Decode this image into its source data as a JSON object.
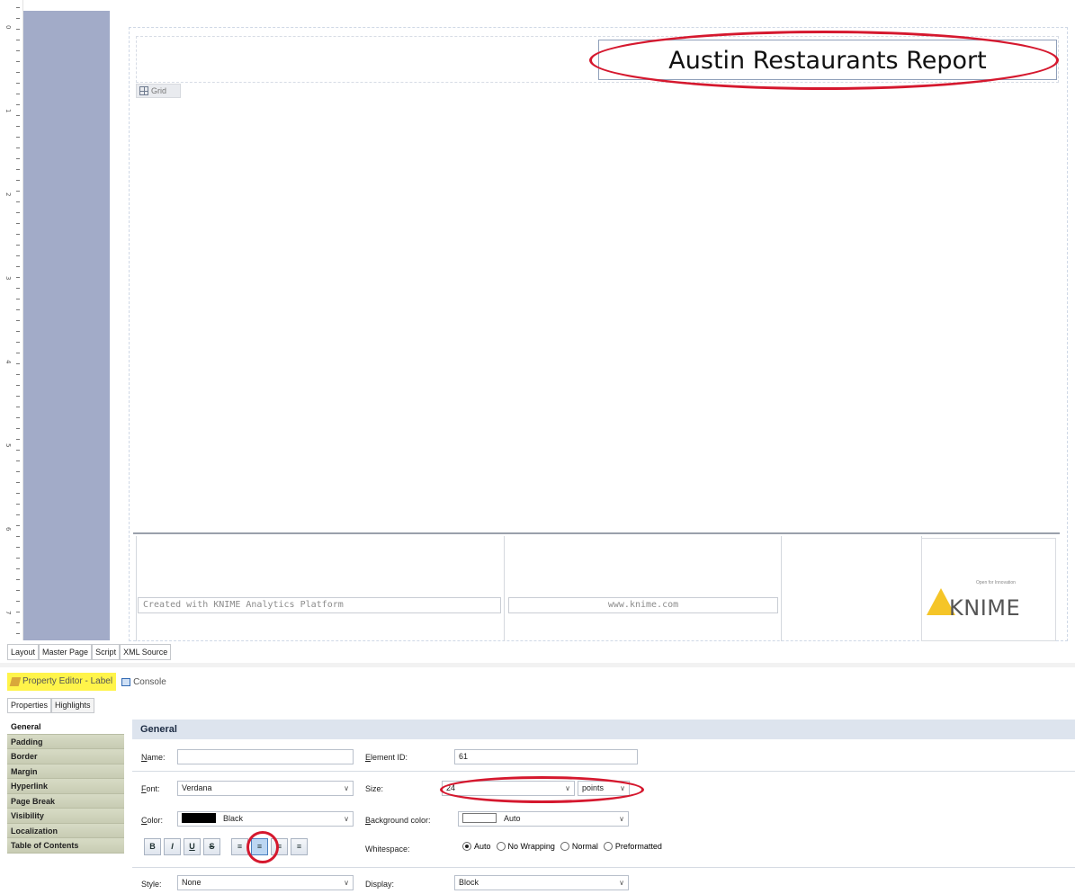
{
  "report": {
    "title": "Austin Restaurants Report",
    "grid_label": "Grid",
    "footer_left": "Created with KNIME Analytics Platform",
    "footer_center": "www.knime.com",
    "logo_word": "KNIME",
    "logo_tagline": "Open for Innovation"
  },
  "ruler": {
    "numbers": [
      "0",
      "1",
      "2",
      "3",
      "4",
      "5",
      "6",
      "7"
    ]
  },
  "editor_tabs": [
    "Layout",
    "Master Page",
    "Script",
    "XML Source"
  ],
  "views": {
    "property_editor": "Property Editor - Label",
    "console": "Console"
  },
  "sub_tabs": [
    "Properties",
    "Highlights"
  ],
  "sidebar": {
    "items": [
      "General",
      "Padding",
      "Border",
      "Margin",
      "Hyperlink",
      "Page Break",
      "Visibility",
      "Localization",
      "Table of Contents"
    ]
  },
  "general": {
    "section_title": "General",
    "name_label": "Name:",
    "name_value": "",
    "element_id_label": "Element ID:",
    "element_id_value": "61",
    "font_label": "Font:",
    "font_value": "Verdana",
    "size_label": "Size:",
    "size_value": "24",
    "size_unit": "points",
    "color_label": "Color:",
    "color_value": "Black",
    "color_swatch": "#000000",
    "bg_color_label": "Background color:",
    "bg_color_value": "Auto",
    "bg_color_swatch": "#ffffff",
    "format_buttons": [
      "B",
      "I",
      "U",
      "S"
    ],
    "whitespace_label": "Whitespace:",
    "whitespace_options": [
      "Auto",
      "No Wrapping",
      "Normal",
      "Preformatted"
    ],
    "whitespace_selected": "Auto",
    "style_label": "Style:",
    "style_value": "None",
    "display_label": "Display:",
    "display_value": "Block"
  },
  "colors": {
    "highlight": "#d5182e",
    "accent_tab": "#fff44a",
    "logo_yellow": "#f5c528"
  }
}
